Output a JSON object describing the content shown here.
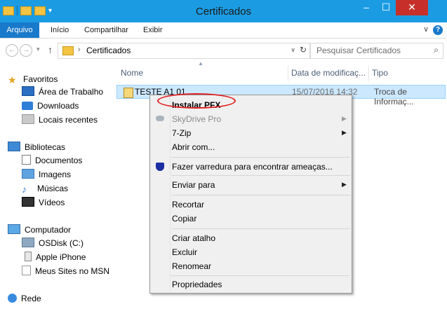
{
  "window": {
    "title": "Certificados",
    "minimize_glyph": "–",
    "maximize_glyph": "☐",
    "close_glyph": "✕"
  },
  "ribbon": {
    "tabs": [
      "Arquivo",
      "Início",
      "Compartilhar",
      "Exibir"
    ],
    "collapse_glyph": "∨",
    "help_glyph": "?"
  },
  "address": {
    "breadcrumb": "Certificados",
    "back_glyph": "←",
    "forward_glyph": "→",
    "up_glyph": "↑",
    "search_placeholder": "Pesquisar Certificados"
  },
  "nav_pane": {
    "favorites": {
      "header": "Favoritos",
      "items": [
        "Área de Trabalho",
        "Downloads",
        "Locais recentes"
      ]
    },
    "libraries": {
      "header": "Bibliotecas",
      "items": [
        "Documentos",
        "Imagens",
        "Músicas",
        "Vídeos"
      ]
    },
    "computer": {
      "header": "Computador",
      "items": [
        "OSDisk (C:)",
        "Apple iPhone",
        "Meus Sites no MSN"
      ]
    },
    "network": {
      "header": "Rede"
    }
  },
  "columns": {
    "name": "Nome",
    "date": "Data de modificaç...",
    "type": "Tipo"
  },
  "file": {
    "name": "TESTE A1 01",
    "date": "15/07/2016 14:32",
    "type": "Troca de Informaç..."
  },
  "context_menu": {
    "items": [
      {
        "label": "Instalar PFX",
        "bold": true
      },
      {
        "label": "SkyDrive Pro",
        "disabled": true,
        "submenu": true
      },
      {
        "label": "7-Zip",
        "submenu": true
      },
      {
        "label": "Abrir com..."
      },
      {
        "label": "Fazer varredura para encontrar ameaças..."
      },
      {
        "label": "Enviar para",
        "submenu": true
      },
      {
        "label": "Recortar"
      },
      {
        "label": "Copiar"
      },
      {
        "label": "Criar atalho"
      },
      {
        "label": "Excluir"
      },
      {
        "label": "Renomear"
      },
      {
        "label": "Propriedades"
      }
    ]
  },
  "colors": {
    "titlebar": "#1b9ce2",
    "file_tab": "#1979ca",
    "selection": "#cce8ff",
    "highlight": "#e02020"
  }
}
